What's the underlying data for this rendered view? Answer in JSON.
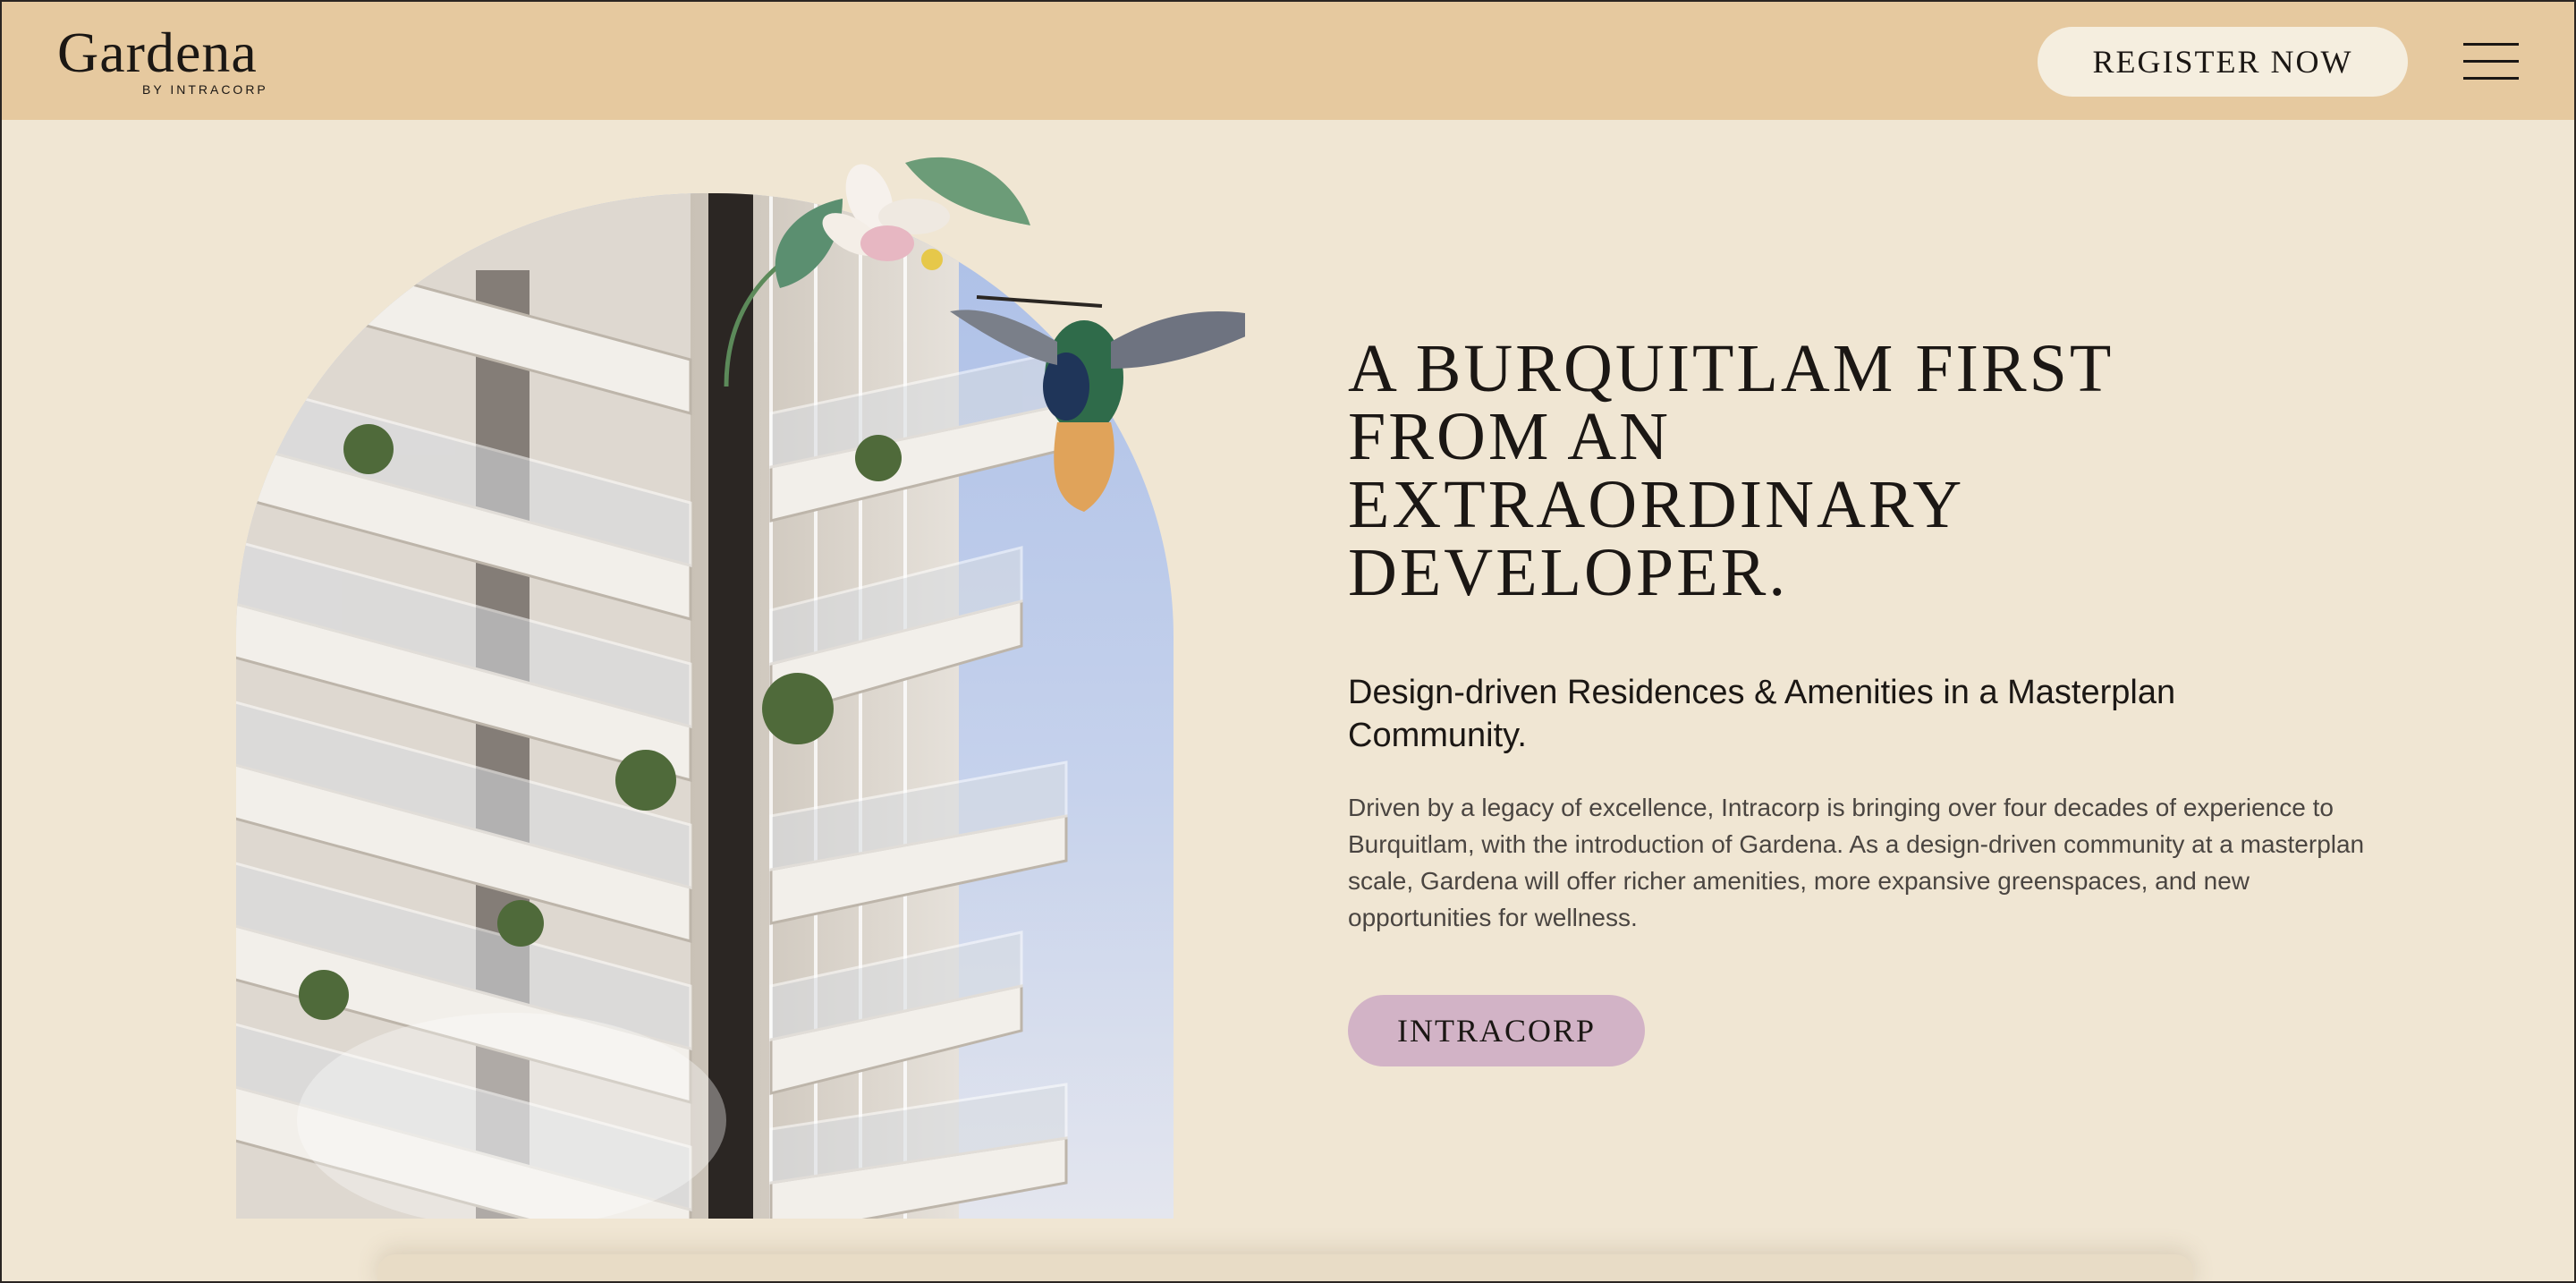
{
  "header": {
    "logo_word": "Gardena",
    "logo_sub": "BY INTRACORP",
    "register_label": "REGISTER NOW",
    "menu_icon": "hamburger-menu-icon"
  },
  "hero": {
    "headline_lines": [
      "A BURQUITLAM FIRST",
      "FROM AN",
      "EXTRAORDINARY",
      "DEVELOPER."
    ],
    "subheading": "Design-driven Residences & Amenities in a Masterplan Community.",
    "body": "Driven by a legacy of excellence, Intracorp is bringing over four decades of experience to Burquitlam, with the introduction of Gardena. As a design-driven community at a masterplan scale, Gardena will offer richer amenities, more expansive greenspaces, and new opportunities for wellness.",
    "cta_label": "INTRACORP",
    "image_icon": "building-arch-image"
  },
  "colors": {
    "header_bg": "#e6c99f",
    "page_bg": "#f0e6d3",
    "register_bg": "#f5eedf",
    "cta_bg": "#d2b3c6",
    "text": "#1b1714"
  }
}
